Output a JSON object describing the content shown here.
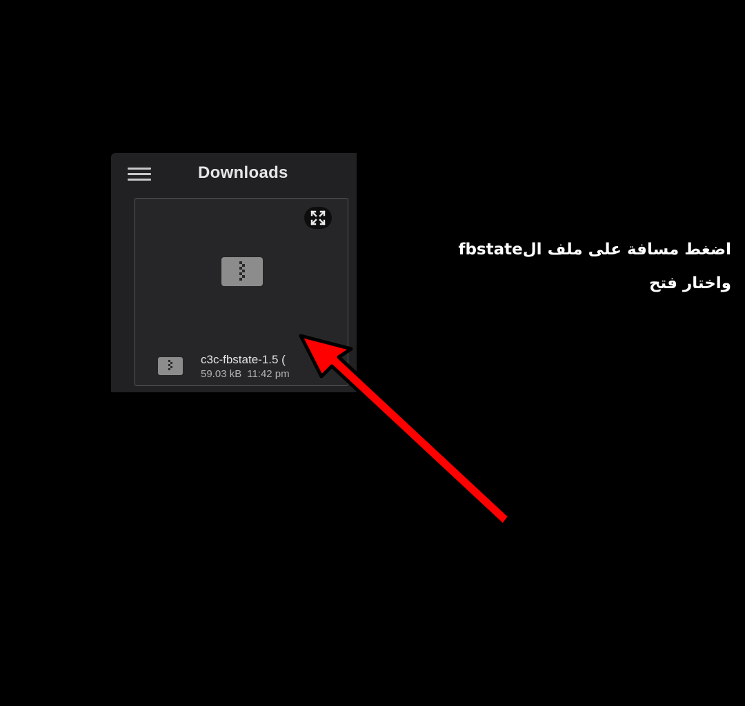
{
  "app": {
    "title": "Downloads"
  },
  "header": {
    "menu_icon": "hamburger-menu-icon"
  },
  "file": {
    "name": "c3c-fbstate-1.5 (",
    "size": "59.03 kB",
    "time": "11:42 pm",
    "type_icon": "zip-archive-icon",
    "expand_icon": "expand-fullscreen-icon"
  },
  "instruction": {
    "line1": "اضغط مسافة على ملف الfbstate",
    "line2": "واختار فتح"
  },
  "colors": {
    "background": "#000000",
    "panel": "#212123",
    "arrow": "#ff0000"
  }
}
